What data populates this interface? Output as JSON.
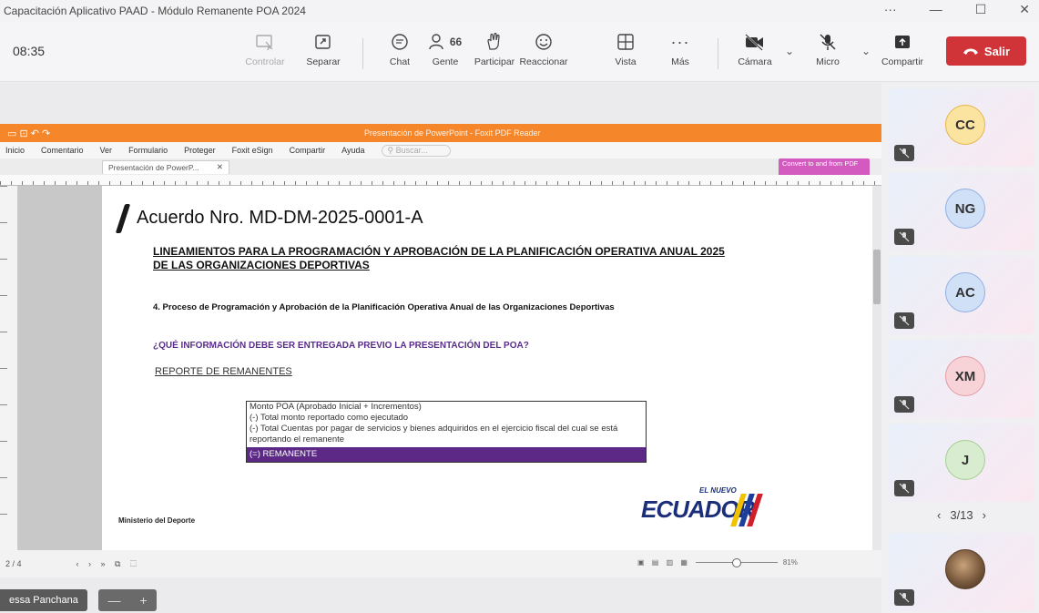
{
  "window": {
    "title": "Capacitación Aplicativo PAAD - Módulo Remanente POA 2024",
    "controls": [
      "···",
      "—",
      "☐",
      "✕"
    ]
  },
  "toolbar": {
    "timer": "08:35",
    "buttons": [
      {
        "label": "Controlar",
        "icon": "control-icon",
        "enabled": false
      },
      {
        "label": "Separar",
        "icon": "pop-out-icon",
        "enabled": true
      },
      {
        "label": "Chat",
        "icon": "chat-icon",
        "enabled": true
      },
      {
        "label": "Gente",
        "icon": "people-icon",
        "enabled": true,
        "count": "66"
      },
      {
        "label": "Participar",
        "icon": "raise-hand-icon",
        "enabled": true
      },
      {
        "label": "Reaccionar",
        "icon": "smile-icon",
        "enabled": true
      },
      {
        "label": "Vista",
        "icon": "grid-icon",
        "enabled": true
      },
      {
        "label": "Más",
        "icon": "more-icon",
        "enabled": true
      },
      {
        "label": "Cámara",
        "icon": "camera-off-icon",
        "enabled": true
      },
      {
        "label": "Micro",
        "icon": "mic-off-icon",
        "enabled": true
      },
      {
        "label": "Compartir",
        "icon": "share-icon",
        "enabled": true
      }
    ],
    "leave_label": "Salir"
  },
  "shared_app": {
    "title": "Presentación de PowerPoint - Foxit PDF Reader",
    "menus": [
      "Inicio",
      "Comentario",
      "Ver",
      "Formulario",
      "Proteger",
      "Foxit eSign",
      "Compartir",
      "Ayuda"
    ],
    "search_placeholder": "Buscar...",
    "tab_label": "Presentación de PowerP...",
    "convert_badge": "Convert to and from PDF",
    "page_indicator": "2 / 4",
    "zoom": "81%"
  },
  "document": {
    "title": "Acuerdo Nro. MD-DM-2025-0001-A",
    "heading": "LINEAMIENTOS PARA LA PROGRAMACIÓN Y APROBACIÓN DE LA PLANIFICACIÓN OPERATIVA ANUAL 2025 DE LAS ORGANIZACIONES DEPORTIVAS",
    "section": "4. Proceso de Programación y Aprobación de la Planificación Operativa Anual de las Organizaciones Deportivas",
    "question": "¿QUÉ INFORMACIÓN DEBE SER ENTREGADA PREVIO LA PRESENTACIÓN DEL POA?",
    "report_title": "REPORTE DE REMANENTES",
    "formula_lines": [
      "Monto POA (Aprobado Inicial + Incrementos)",
      "(-) Total monto reportado como ejecutado",
      "(-) Total Cuentas por pagar de servicios y bienes adquiridos en el ejercicio fiscal del cual se está reportando el remanente"
    ],
    "formula_total": "(=) REMANENTE",
    "footer_left": "Ministerio del Deporte",
    "logo_small": "EL NUEVO",
    "logo_big": "ECUADOR",
    "colors": {
      "accent_purple": "#5c2a86",
      "heading_purple": "#5a2d8c",
      "foxit_orange": "#f5862a"
    }
  },
  "presenter": {
    "name": "essa Panchana"
  },
  "participants": [
    {
      "initials": "CC",
      "color": "#fbe3a0",
      "ring": "#e6b64b",
      "muted": true
    },
    {
      "initials": "NG",
      "color": "#cfe0f7",
      "ring": "#8fb0e4",
      "muted": true
    },
    {
      "initials": "AC",
      "color": "#cfe0f7",
      "ring": "#8fb0e4",
      "muted": true
    },
    {
      "initials": "XM",
      "color": "#f7d3d7",
      "ring": "#e69aa4",
      "muted": true
    },
    {
      "initials": "J",
      "color": "#d8ecd0",
      "ring": "#a4cf91",
      "muted": true
    },
    {
      "initials": "",
      "color": "#7a5a3e",
      "ring": "#5a3e28",
      "muted": true,
      "photo": true
    }
  ],
  "pager": {
    "text": "3/13"
  },
  "colors": {
    "leave_red": "#d13438"
  }
}
